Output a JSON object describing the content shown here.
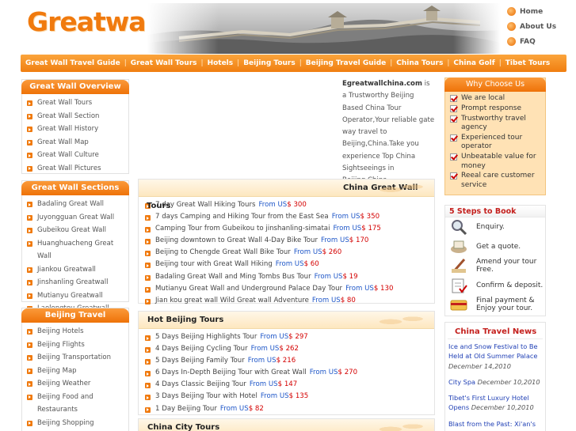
{
  "header": {
    "logo_text": "Greatwall",
    "top_links": [
      "Home",
      "About Us",
      "FAQ"
    ]
  },
  "nav": {
    "items": [
      "Great Wall Travel Guide",
      "Great Wall Tours",
      "Hotels",
      "Beijing Tours",
      "Beijing Travel Guide",
      "China Tours",
      "China Golf",
      "Tibet Tours"
    ]
  },
  "left": {
    "overview": {
      "title": "Great Wall Overview",
      "items": [
        "Great Wall Tours",
        "Great Wall Section",
        "Great Wall History",
        "Great Wall Map",
        "Great Wall Culture",
        "Great Wall Pictures"
      ]
    },
    "sections": {
      "title": "Great Wall Sections",
      "items": [
        "Badaling Great Wall",
        "Juyongguan Great Wall",
        "Gubeikou Great Wall",
        "Huanghuacheng Great Wall",
        "Jiankou Greatwall",
        "Jinshanling Greatwall",
        "Mutianyu Greatwall",
        "Laolongtou Greatwall"
      ]
    },
    "beijing": {
      "title": "Beijing Travel",
      "items": [
        "Beijing Hotels",
        "Beijing Flights",
        "Beijing Transportation",
        "Beijing Map",
        "Beijing Weather",
        "Beijing Food and Restaurants",
        "Beijing Shopping"
      ]
    }
  },
  "intro": {
    "brand": "Egreatwallchina.com",
    "text": " is a Trustworthy Beijing Based China Tour Operator,Your reliable gate way travel to Beijing,China.Take you experience Top China Sightseeings in Beijing,China."
  },
  "china_great_wall": {
    "title": "China Great Wall",
    "overlay_text": "Tours",
    "tours": [
      {
        "name": "7 day Great Wall Hiking Tours",
        "from": "From US",
        "price": "$ 300"
      },
      {
        "name": "7 days Camping and Hiking Tour from the East Sea",
        "from": "From US",
        "price": "$ 350"
      },
      {
        "name": "Camping Tour from Gubeikou to jinshanling-simatai",
        "from": "From US",
        "price": "$ 175"
      },
      {
        "name": "Beijing downtown to Great Wall 4-Day Bike Tour",
        "from": "From US",
        "price": "$ 170"
      },
      {
        "name": "Beijing to Chengde Great Wall Bike Tour",
        "from": "From US",
        "price": "$ 260"
      },
      {
        "name": "Beijing tour with Great Wall Hiking",
        "from": "From US",
        "price": "$ 60"
      },
      {
        "name": "Badaling Great Wall and Ming Tombs Bus Tour",
        "from": "From US",
        "price": "$ 19"
      },
      {
        "name": "Mutianyu Great Wall and Underground Palace Day Tour",
        "from": "From US",
        "price": "$ 130"
      },
      {
        "name": "Jian kou great wall Wild Great wall Adventure",
        "from": "From US",
        "price": "$ 80"
      }
    ]
  },
  "hot_beijing": {
    "title": "Hot Beijing Tours",
    "tours": [
      {
        "name": "5 Days Beijing Highlights Tour",
        "from": "From US",
        "price": "$ 297"
      },
      {
        "name": "4 Days Beijing Cycling Tour",
        "from": "From US",
        "price": "$ 262"
      },
      {
        "name": "5 Days Beijing Family Tour",
        "from": "From US",
        "price": "$ 216"
      },
      {
        "name": "6 Days In-Depth Beijing Tour with Great Wall",
        "from": "From US",
        "price": "$ 270"
      },
      {
        "name": "4 Days Classic Beijing Tour",
        "from": "From US",
        "price": "$ 147"
      },
      {
        "name": "3 Days Beijing Tour with Hotel",
        "from": "From US",
        "price": "$ 135"
      },
      {
        "name": "1 Day Beijing Tour",
        "from": "From US",
        "price": "$ 82"
      }
    ]
  },
  "china_city": {
    "title": "China City Tours"
  },
  "why": {
    "title": "Why Choose Us",
    "items": [
      "We are local",
      "Prompt response",
      "Trustworthy travel agency",
      "Experienced tour operator",
      "Unbeatable value for money",
      "Reeal care customer service"
    ]
  },
  "steps": {
    "title": "5 Steps to Book",
    "items": [
      "Enquiry.",
      "Get a quote.",
      "Amend your tour Free.",
      "Confirm & deposit.",
      "Final payment & Enjoy your tour."
    ],
    "icons": [
      "magnifier-icon",
      "quote-icon",
      "amend-icon",
      "confirm-icon",
      "payment-icon"
    ]
  },
  "news": {
    "title": "China Travel News",
    "items": [
      {
        "title": "Ice and Snow Festival to Be Held at Old Summer Palace",
        "date": "December 14,2010"
      },
      {
        "title": "City Spa",
        "date": "December 10,2010"
      },
      {
        "title": "Tibet's First Luxury Hotel Opens",
        "date": "December 10,2010"
      },
      {
        "title": "Blast from the Past: Xi'an's",
        "date": ""
      }
    ]
  }
}
